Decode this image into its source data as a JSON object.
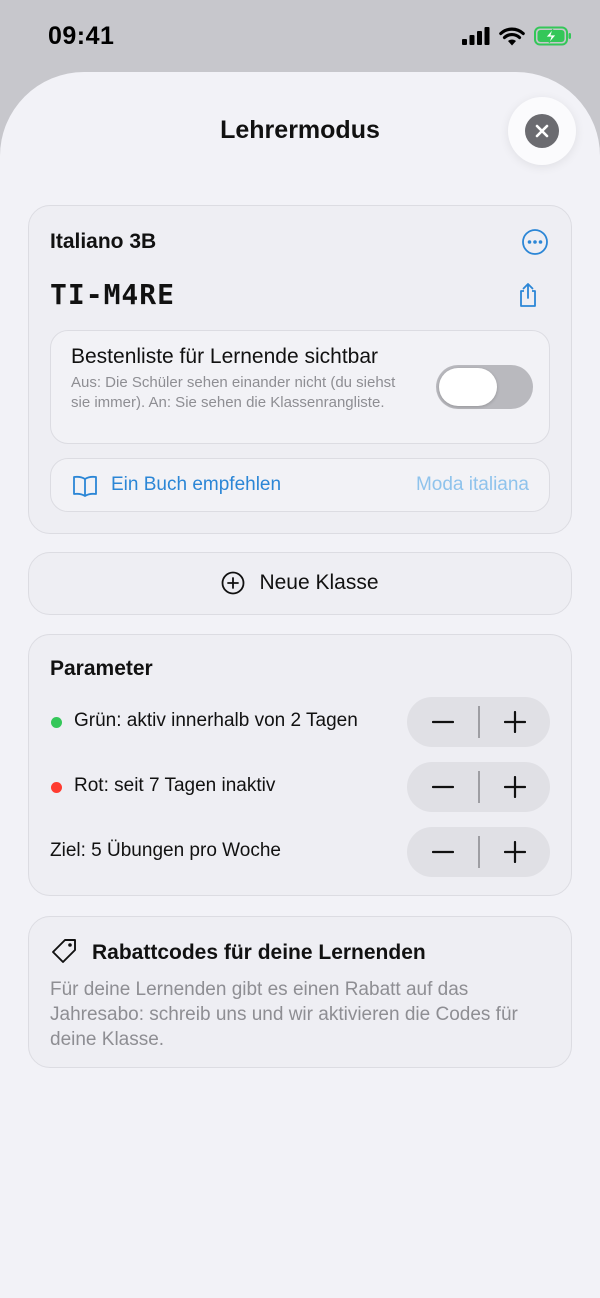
{
  "status_bar": {
    "time": "09:41"
  },
  "sheet": {
    "title": "Lehrermodus"
  },
  "class_card": {
    "name": "Italiano 3B",
    "code": "TI-M4RE",
    "leaderboard": {
      "title": "Bestenliste für Lernende sichtbar",
      "description": "Aus: Die Schüler sehen einander nicht (du siehst sie immer). An: Sie sehen die Klassenrangliste.",
      "enabled": false
    },
    "book": {
      "label": "Ein Buch empfehlen",
      "value": "Moda italiana"
    }
  },
  "new_class": {
    "label": "Neue Klasse"
  },
  "parameters": {
    "title": "Parameter",
    "rows": [
      {
        "label": "Grün: aktiv innerhalb von 2 Tagen",
        "dot_color": "#34c759"
      },
      {
        "label": "Rot: seit 7 Tagen inaktiv",
        "dot_color": "#ff3b30"
      },
      {
        "label": "Ziel: 5 Übungen pro Woche"
      }
    ]
  },
  "discount": {
    "title": "Rabattcodes für deine Lernenden",
    "text": "Für deine Lernenden gibt es einen Rabatt auf das Jahresabo: schreib uns und wir aktivieren die Codes für deine Klasse."
  },
  "colors": {
    "accent": "#2b86d6",
    "accent_light": "#8fc3ec",
    "sheet_bg": "#f2f2f7"
  }
}
